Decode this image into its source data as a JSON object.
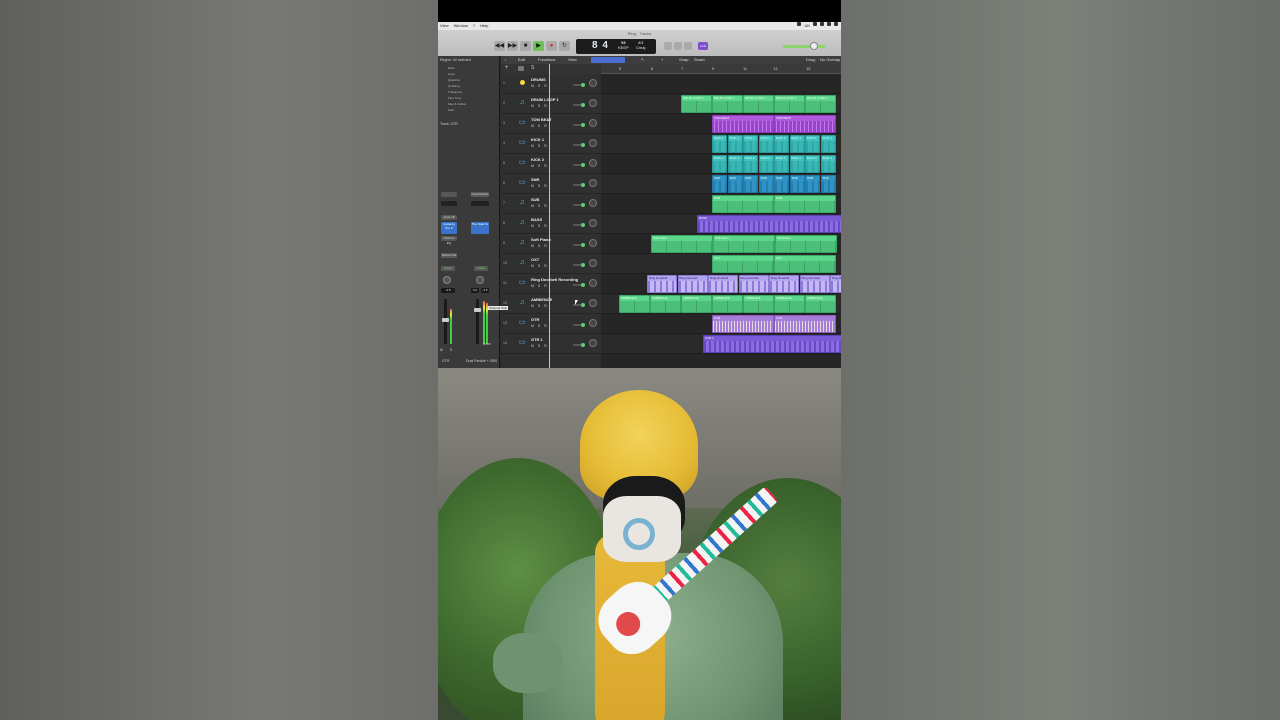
{
  "menubar": {
    "items": [
      "View",
      "Window",
      "?",
      "Help"
    ],
    "right_label": "UK"
  },
  "window": {
    "title": "Ring - Tracks"
  },
  "transport": {
    "buttons": [
      "◀◀",
      "▶▶",
      "■",
      "▶",
      "●",
      "↻"
    ],
    "position": "8 4",
    "tempo_value": "93",
    "tempo_label": "KEEP",
    "signature": "4/4",
    "key": "Cmaj",
    "lcd_mode": "LCD"
  },
  "inspector": {
    "region_label": "Region: 62 selected",
    "params": [
      "Mute",
      "Loop",
      "Quantize",
      "Q-Swing",
      "Transpose",
      "Fine Tune",
      "Flex & Follow",
      "Gain"
    ],
    "track_label": "Track: GTR",
    "plugins_left": [
      "Input 18",
      "Channel EQ"
    ],
    "plugins_left_blue": "Guitarrig Pro 8",
    "plugins_right": [
      "Dual Particle"
    ],
    "plugins_right_blue": "The Dual Fx",
    "stereo_out": "Stereo Out",
    "read": [
      "Read",
      "Read"
    ],
    "values": [
      "-3.8",
      "0.0",
      "-3.5"
    ],
    "footer": [
      "GTR",
      "Dual Particle + GBS"
    ],
    "btn_labels": [
      "M",
      "S",
      "Bnce"
    ]
  },
  "toolbar": {
    "edit": "Edit",
    "functions": "Functions",
    "view": "View",
    "snap_label": "Snap:",
    "snap_value": "Smart",
    "drag_label": "Drag:",
    "drag_value": "No Overlap"
  },
  "ruler": [
    "5",
    "6",
    "7",
    "9",
    "11",
    "13",
    "15"
  ],
  "tracks": [
    {
      "num": "1",
      "name": "DRUMS",
      "type": "yellow"
    },
    {
      "num": "2",
      "name": "DRUM LOOP 1",
      "type": "midi"
    },
    {
      "num": "3",
      "name": "TOM BEAT",
      "type": "audio"
    },
    {
      "num": "4",
      "name": "KICK 1",
      "type": "audio"
    },
    {
      "num": "5",
      "name": "KICK 2",
      "type": "audio"
    },
    {
      "num": "6",
      "name": "SNR",
      "type": "audio"
    },
    {
      "num": "7",
      "name": "SUB",
      "type": "midi"
    },
    {
      "num": "8",
      "name": "BASS",
      "type": "midi"
    },
    {
      "num": "9",
      "name": "Soft Piano",
      "type": "midi"
    },
    {
      "num": "10",
      "name": "OXT",
      "type": "midi"
    },
    {
      "num": "11",
      "name": "Ring Doorbell Recording",
      "type": "audio"
    },
    {
      "num": "12",
      "name": "AMBIENCE",
      "type": "midi"
    },
    {
      "num": "13",
      "name": "GTR",
      "type": "audio"
    },
    {
      "num": "14",
      "name": "GTR 1",
      "type": "audio"
    }
  ],
  "track_controls": "M S R",
  "tooltip": "Channel Strip",
  "regions": [
    {
      "lane": 1,
      "color": "g",
      "labels": [
        "DRUM LOOP 1",
        "DRUM LOOP 1",
        "DRUM LOOP 1",
        "DRUM LOOP 1",
        "DRUM LOOP 1"
      ]
    },
    {
      "lane": 2,
      "color": "p",
      "labels": [
        "TOM BEAT",
        "TOM BEAT"
      ]
    },
    {
      "lane": 3,
      "color": "t",
      "labels": [
        "KICK 1",
        "KICK 1",
        "KICK 1",
        "KICK 1",
        "KICK 1",
        "KICK 1",
        "KICK 1",
        "KICK 1"
      ]
    },
    {
      "lane": 4,
      "color": "t",
      "labels": [
        "KICK 2",
        "KICK 2",
        "KICK 2",
        "KICK 2",
        "KICK 2",
        "KICK 2",
        "KICK 2",
        "KICK 2"
      ]
    },
    {
      "lane": 5,
      "color": "b",
      "labels": [
        "SNR",
        "SNR",
        "SNR",
        "SNR",
        "SNR",
        "SNR",
        "SNR",
        "SNR"
      ]
    },
    {
      "lane": 6,
      "color": "g",
      "labels": [
        "SUB",
        "SUB"
      ]
    },
    {
      "lane": 7,
      "color": "v",
      "labels": [
        "BASS"
      ]
    },
    {
      "lane": 8,
      "color": "g",
      "labels": [
        "Soft Piano",
        "Soft Piano",
        "Soft Piano"
      ]
    },
    {
      "lane": 9,
      "color": "g",
      "labels": [
        "OXT",
        "OXT"
      ]
    },
    {
      "lane": 10,
      "color": "lv",
      "labels": [
        "Ring Doorbell",
        "Ring Doorbell",
        "Ring Doorbell",
        "Ring Doorbell",
        "Ring Doorbell",
        "Ring Doorbell",
        "Ring Doorbell"
      ]
    },
    {
      "lane": 11,
      "color": "g",
      "labels": [
        "AMBIENCE",
        "AMBIENCE",
        "AMBIENCE",
        "AMBIENCE",
        "AMBIENCE",
        "AMBIENCE",
        "AMBIENCE"
      ]
    },
    {
      "lane": 12,
      "color": "ww",
      "labels": [
        "GTR",
        "GTR"
      ]
    },
    {
      "lane": 13,
      "color": "v",
      "labels": [
        "GTR 1"
      ]
    }
  ]
}
